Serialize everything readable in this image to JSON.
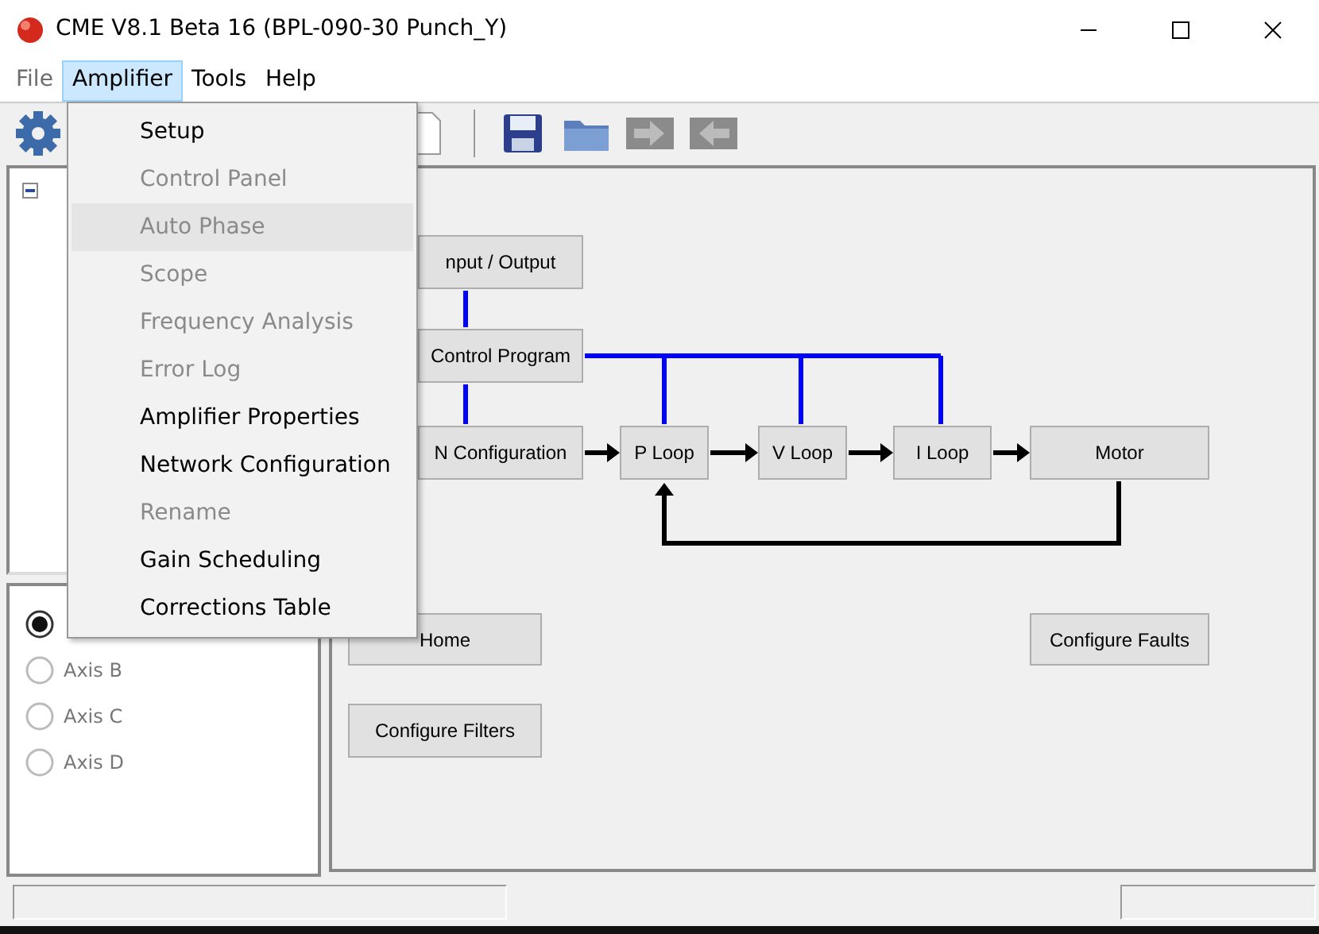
{
  "window": {
    "title": "CME V8.1 Beta 16 (BPL-090-30 Punch_Y)"
  },
  "menubar": [
    {
      "label": "File",
      "selected": false,
      "disabled": true
    },
    {
      "label": "Amplifier",
      "selected": true,
      "disabled": false
    },
    {
      "label": "Tools",
      "selected": false,
      "disabled": false
    },
    {
      "label": "Help",
      "selected": false,
      "disabled": false
    }
  ],
  "menu": [
    {
      "label": "Setup",
      "disabled": false,
      "selected": false
    },
    {
      "label": "Control Panel",
      "disabled": true,
      "selected": false
    },
    {
      "label": "Auto Phase",
      "disabled": true,
      "selected": true
    },
    {
      "label": "Scope",
      "disabled": true,
      "selected": false
    },
    {
      "label": "Frequency Analysis",
      "disabled": true,
      "selected": false
    },
    {
      "label": "Error Log",
      "disabled": true,
      "selected": false
    },
    {
      "label": "Amplifier Properties",
      "disabled": false,
      "selected": false
    },
    {
      "label": "Network Configuration",
      "disabled": false,
      "selected": false
    },
    {
      "label": "Rename",
      "disabled": true,
      "selected": false
    },
    {
      "label": "Gain Scheduling",
      "disabled": false,
      "selected": false
    },
    {
      "label": "Corrections Table",
      "disabled": false,
      "selected": false
    }
  ],
  "toolbar": [
    {
      "kind": "gear"
    },
    {
      "kind": "document"
    },
    {
      "kind": "separator"
    },
    {
      "kind": "save"
    },
    {
      "kind": "folder"
    },
    {
      "kind": "forward",
      "disabled": true
    },
    {
      "kind": "back",
      "disabled": true
    }
  ],
  "axes": [
    {
      "selected": true
    },
    {
      "label": "Axis B",
      "selected": false
    },
    {
      "label": "Axis C",
      "selected": false
    },
    {
      "label": "Axis D",
      "selected": false
    }
  ],
  "diagram": [
    {
      "label": "nput / Output"
    },
    {
      "label": "Control Program"
    },
    {
      "label": "N Configuration"
    },
    {
      "label": "P  Loop"
    },
    {
      "label": "V  Loop"
    },
    {
      "label": "I Loop"
    },
    {
      "label": "Motor"
    },
    {
      "label": "Home"
    },
    {
      "label": "Configure Filters"
    },
    {
      "label": "Configure Faults"
    }
  ]
}
